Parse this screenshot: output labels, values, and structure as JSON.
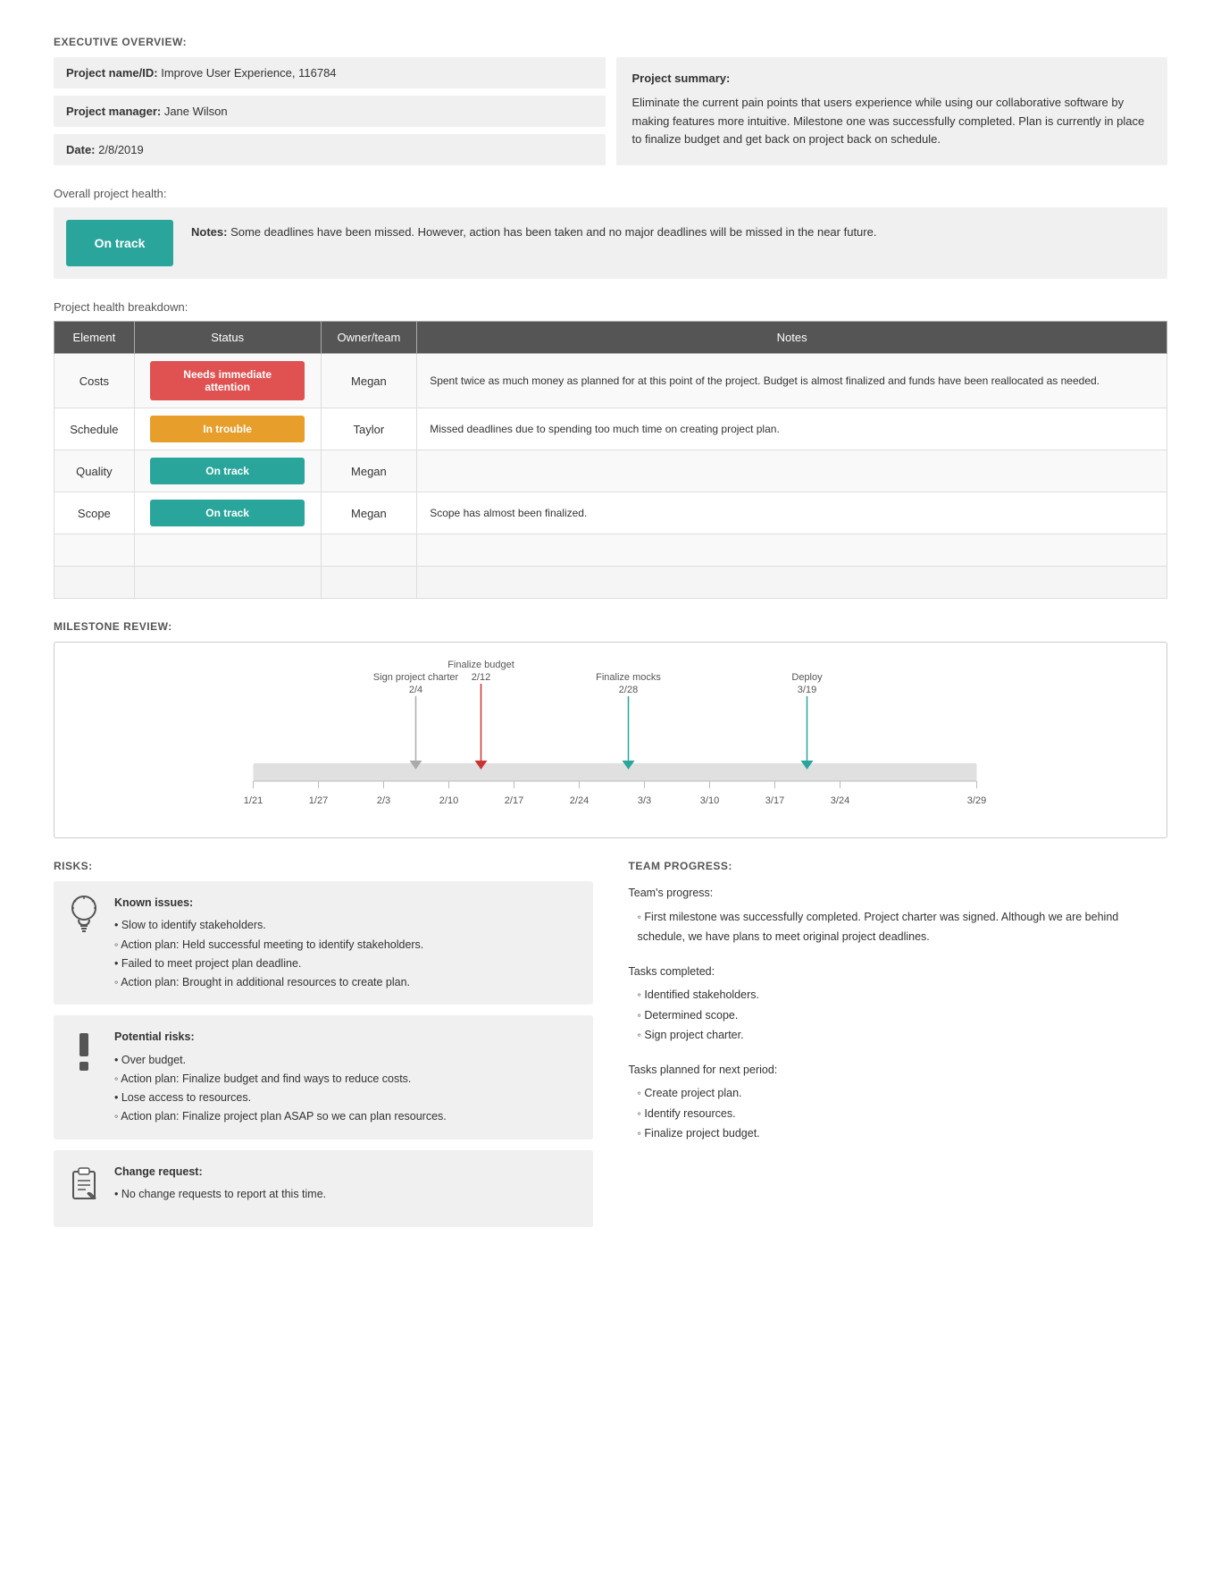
{
  "exec": {
    "section_title": "EXECUTIVE OVERVIEW:",
    "project_name_label": "Project name/ID:",
    "project_name_value": "Improve User Experience, 116784",
    "manager_label": "Project manager:",
    "manager_value": "Jane Wilson",
    "date_label": "Date:",
    "date_value": "2/8/2019",
    "summary_label": "Project summary:",
    "summary_text": "Eliminate the current pain points that users experience while using our collaborative software by making features more intuitive. Milestone one was successfully completed. Plan is currently in place to finalize budget and get back on project back on schedule."
  },
  "overall_health": {
    "label": "Overall project health:",
    "badge": "On track",
    "notes_label": "Notes:",
    "notes_text": "Some deadlines have been missed. However, action has been taken and no major deadlines will be missed in the near future."
  },
  "breakdown": {
    "label": "Project health breakdown:",
    "headers": [
      "Element",
      "Status",
      "Owner/team",
      "Notes"
    ],
    "rows": [
      {
        "element": "Costs",
        "status": "Needs immediate attention",
        "status_type": "needs",
        "owner": "Megan",
        "notes": "Spent twice as much money as planned for at this point of the project. Budget is almost finalized and funds have been reallocated as needed."
      },
      {
        "element": "Schedule",
        "status": "In trouble",
        "status_type": "trouble",
        "owner": "Taylor",
        "notes": "Missed deadlines due to spending too much time on creating project plan."
      },
      {
        "element": "Quality",
        "status": "On track",
        "status_type": "ontrack",
        "owner": "Megan",
        "notes": ""
      },
      {
        "element": "Scope",
        "status": "On track",
        "status_type": "ontrack",
        "owner": "Megan",
        "notes": "Scope has almost been finalized."
      }
    ]
  },
  "milestone": {
    "section_title": "MILESTONE REVIEW:",
    "milestones": [
      {
        "label": "Sign project charter",
        "date": "2/4",
        "color": "gray",
        "arrow": "down",
        "pos_pct": 17
      },
      {
        "label": "Finalize budget",
        "date": "2/12",
        "color": "red",
        "arrow": "down",
        "pos_pct": 32
      },
      {
        "label": "Finalize mocks",
        "date": "2/28",
        "color": "teal",
        "arrow": "down",
        "pos_pct": 57
      },
      {
        "label": "Deploy",
        "date": "3/19",
        "color": "teal",
        "arrow": "down",
        "pos_pct": 80
      }
    ],
    "axis_labels": [
      "1/21",
      "1/27",
      "2/3",
      "2/10",
      "2/17",
      "2/24",
      "3/3",
      "3/10",
      "3/17",
      "3/24",
      "3/29"
    ]
  },
  "risks": {
    "section_title": "RISKS:",
    "items": [
      {
        "icon": "lightbulb",
        "title": "Known issues:",
        "lines": [
          "• Slow to identify stakeholders.",
          "  ◦ Action plan: Held successful meeting to identify stakeholders.",
          "• Failed to meet project plan deadline.",
          "  ◦ Action plan: Brought in additional resources to create plan."
        ]
      },
      {
        "icon": "exclamation",
        "title": "Potential risks:",
        "lines": [
          "• Over budget.",
          "  ◦ Action plan: Finalize budget and find ways to reduce costs.",
          "• Lose access to resources.",
          "  ◦ Action plan: Finalize project plan ASAP so we can plan resources."
        ]
      },
      {
        "icon": "clipboard",
        "title": "Change request:",
        "lines": [
          "• No change requests to report at this time."
        ]
      }
    ]
  },
  "team": {
    "section_title": "TEAM PROGRESS:",
    "progress_label": "Team's progress:",
    "progress_items": [
      "First milestone was successfully completed. Project charter was signed. Although we are behind schedule, we have plans to meet original project deadlines."
    ],
    "completed_label": "Tasks completed:",
    "completed_items": [
      "Identified stakeholders.",
      "Determined scope.",
      "Sign project charter."
    ],
    "planned_label": "Tasks planned for next period:",
    "planned_items": [
      "Create project plan.",
      "Identify resources.",
      "Finalize project budget."
    ]
  }
}
